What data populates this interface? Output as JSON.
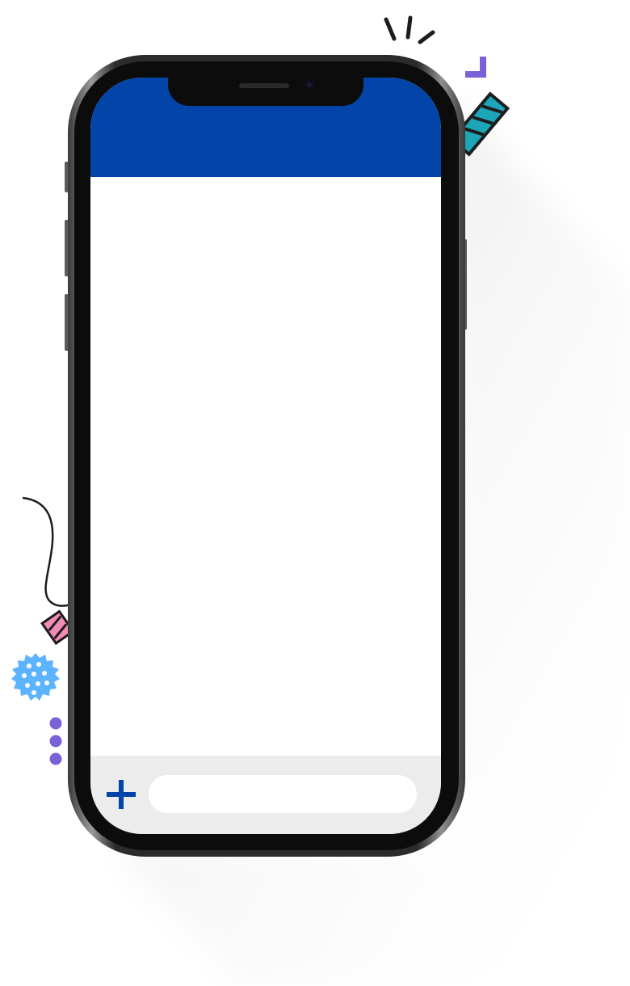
{
  "app": {
    "header_title": "",
    "composer": {
      "add_icon": "plus-icon",
      "input_value": "",
      "input_placeholder": ""
    }
  },
  "colors": {
    "header": "#0344a8",
    "composer_bar": "#ececec",
    "add_icon": "#0344a8",
    "deco_purple": "#7b61d8",
    "deco_teal": "#1ca6b8",
    "deco_pink": "#f28bb6",
    "deco_blue": "#5cb3ff"
  }
}
